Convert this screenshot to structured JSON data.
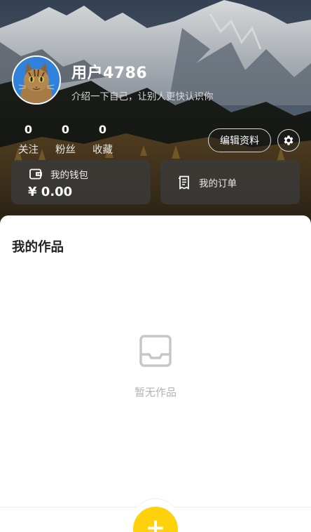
{
  "profile": {
    "username": "用户4786",
    "bio": "介绍一下自己，让别人更快认识你",
    "avatar_icon": "cat-avatar"
  },
  "stats": [
    {
      "value": "0",
      "label": "关注"
    },
    {
      "value": "0",
      "label": "粉丝"
    },
    {
      "value": "0",
      "label": "收藏"
    }
  ],
  "actions": {
    "edit_label": "编辑资料",
    "settings_icon": "gear-icon"
  },
  "wallet": {
    "title": "我的钱包",
    "amount": "¥ 0.00",
    "icon": "wallet-icon"
  },
  "orders": {
    "title": "我的订单",
    "icon": "receipt-icon"
  },
  "works": {
    "title": "我的作品",
    "empty_text": "暂无作品",
    "empty_icon": "inbox-icon"
  },
  "fab": {
    "label": "+",
    "color": "#fdd20c"
  }
}
